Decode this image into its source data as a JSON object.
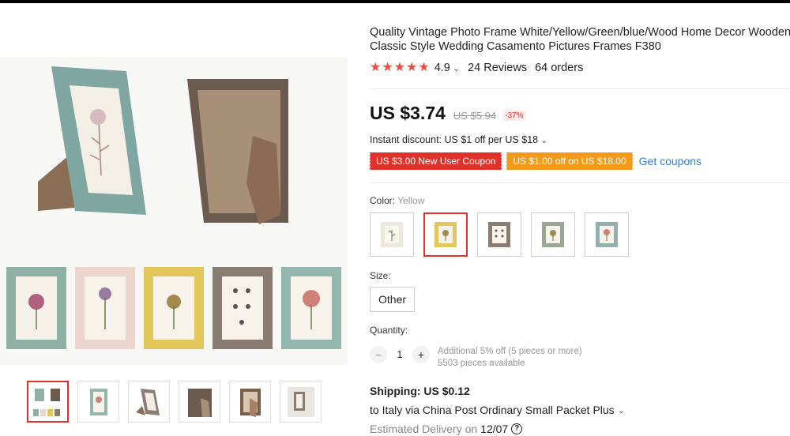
{
  "product": {
    "title_line1": "Quality Vintage Photo Frame White/Yellow/Green/blue/Wood Home Decor Wooden",
    "title_line2": "Classic Style Wedding Casamento Pictures Frames F380",
    "rating": "4.9",
    "reviews": "24 Reviews",
    "orders": "64 orders",
    "stars_icon": "star-icon",
    "star_color": "#f04a3e"
  },
  "price": {
    "current": "US $3.74",
    "original": "US $5.94",
    "discount": "-37%"
  },
  "instant_discount": "Instant discount: US $1 off per US $18",
  "coupons": {
    "new_user": "US $3.00 New User Coupon",
    "store": "US $1.00 off on US $18.00",
    "get_label": "Get coupons"
  },
  "color": {
    "label": "Color:",
    "selected": "Yellow",
    "options": [
      "White",
      "Yellow",
      "Wood",
      "Green",
      "Blue"
    ],
    "selected_index": 1
  },
  "size": {
    "label": "Size:",
    "option": "Other"
  },
  "quantity": {
    "label": "Quantity:",
    "minus": "−",
    "value": "1",
    "plus": "+",
    "note1": "Additional 5% off (5 pieces or more)",
    "note2": "5503 pieces available"
  },
  "shipping": {
    "title": "Shipping: US $0.12",
    "route": "to Italy via China Post Ordinary Small Packet Plus",
    "delivery_prefix": "Estimated Delivery on",
    "delivery_date": "12/07",
    "help_icon": "question-circle-icon"
  },
  "gallery": {
    "thumb_count": 6,
    "active_index": 0
  },
  "colors": {
    "accent_red": "#e0322b",
    "coupon_orange": "#f39a1a",
    "link_blue": "#2f7fd1"
  }
}
